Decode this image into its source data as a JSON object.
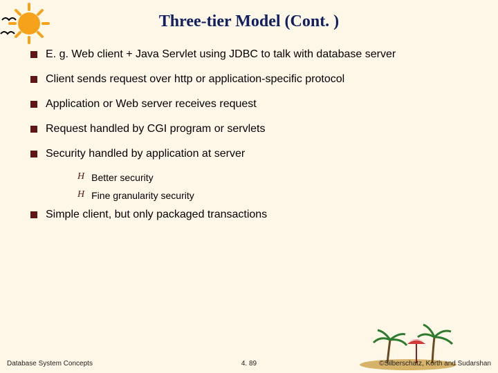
{
  "title": "Three-tier Model (Cont. )",
  "bullets": [
    "E. g. Web client + Java Servlet using JDBC to talk with database server",
    "Client sends request over http or application-specific protocol",
    "Application or Web server receives request",
    "Request handled by CGI program or servlets",
    "Security handled by application at server",
    "Simple client, but only packaged transactions"
  ],
  "subbullets_after_index": 4,
  "subbullets": [
    "Better security",
    "Fine granularity security"
  ],
  "footer": {
    "left": "Database System Concepts",
    "center": "4. 89",
    "right": "©Silberschatz, Korth and Sudarshan"
  },
  "icons": {
    "sun": "sun-icon",
    "bird": "bird-icon",
    "island": "island-icon"
  },
  "colors": {
    "background": "#fff7e8",
    "title": "#102060",
    "bullet_square": "#601616"
  }
}
